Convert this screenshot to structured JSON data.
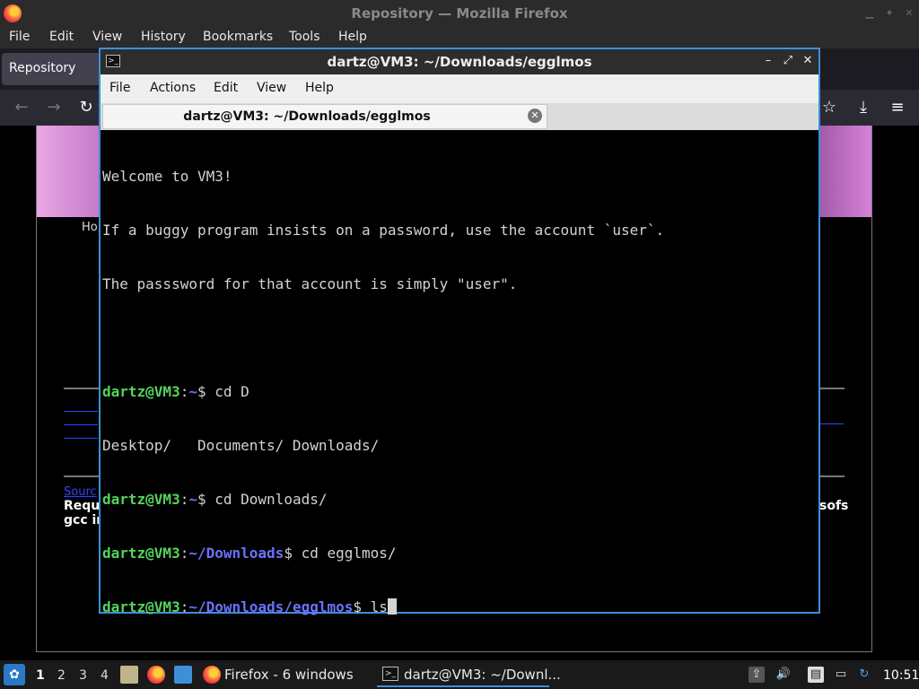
{
  "firefox": {
    "window_title": "Repository — Mozilla Firefox",
    "menu": [
      "File",
      "Edit",
      "View",
      "History",
      "Bookmarks",
      "Tools",
      "Help"
    ],
    "tab_title": "Repository",
    "page": {
      "partial_texts": [
        "Ho",
        "Sourc",
        "Requi",
        "gcc in",
        "sofs"
      ]
    }
  },
  "terminal": {
    "window_title": "dartz@VM3: ~/Downloads/egglmos",
    "menu": [
      "File",
      "Actions",
      "Edit",
      "View",
      "Help"
    ],
    "tab_title": "dartz@VM3: ~/Downloads/egglmos",
    "lines": {
      "l1": "Welcome to VM3!",
      "l2": "If a buggy program insists on a password, use the account `user`.",
      "l3": "The passsword for that account is simply \"user\".",
      "l5_user": "dartz@VM3",
      "l5_path": "~",
      "l5_cmd": "$ cd D",
      "l6": "Desktop/   Documents/ Downloads/",
      "l7_user": "dartz@VM3",
      "l7_path": "~",
      "l7_cmd": "$ cd Downloads/",
      "l8_user": "dartz@VM3",
      "l8_path": "~/Downloads",
      "l8_cmd": "$ cd egglmos/",
      "l9_user": "dartz@VM3",
      "l9_path": "~/Downloads/egglmos",
      "l9_cmd": "$ ls"
    }
  },
  "taskbar": {
    "workspaces": [
      "1",
      "2",
      "3",
      "4"
    ],
    "tasks": [
      {
        "label": "Firefox - 6 windows"
      },
      {
        "label": "dartz@VM3: ~/Downl..."
      }
    ],
    "clock": "10:51"
  }
}
